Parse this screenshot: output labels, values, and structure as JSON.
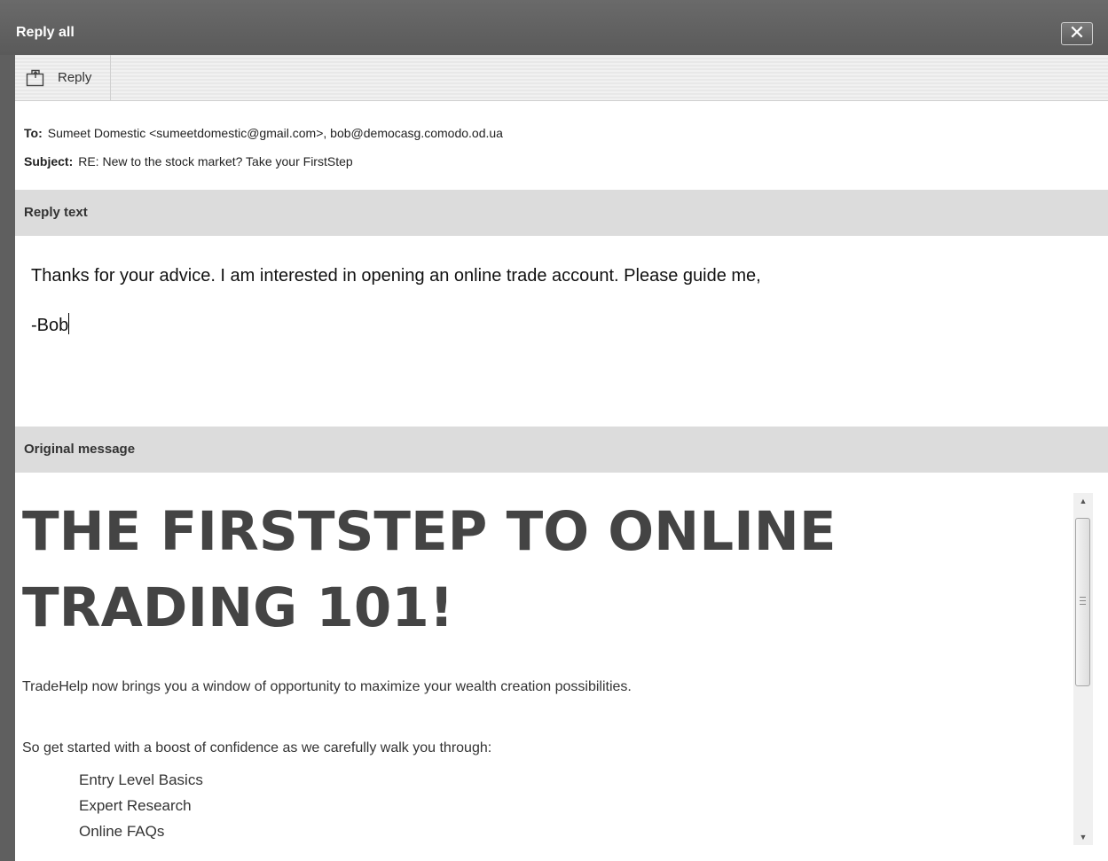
{
  "window": {
    "title": "Reply all",
    "close_label": "✕"
  },
  "toolbar": {
    "reply_label": "Reply"
  },
  "header": {
    "to_label": "To:",
    "to_value": "Sumeet Domestic <sumeetdomestic@gmail.com>, bob@democasg.comodo.od.ua",
    "subject_label": "Subject:",
    "subject_value": "RE: New to the stock market? Take your FirstStep"
  },
  "sections": {
    "reply_text_label": "Reply text",
    "original_message_label": "Original message"
  },
  "reply": {
    "line1": "Thanks for your advice. I am interested in opening an online trade account. Please guide me,",
    "line2": "-Bob"
  },
  "original": {
    "heading": "THE FIRSTSTEP TO ONLINE TRADING 101!",
    "para1": "TradeHelp now brings you a window of opportunity to maximize your wealth creation possibilities.",
    "para2": "So get started with a boost of confidence as we carefully walk you through:",
    "list": [
      "Entry Level Basics",
      "Expert Research",
      "Online FAQs"
    ]
  },
  "colors": {
    "titlebar": "#5f5f5f",
    "section_bar": "#dcdcdc",
    "heading_text": "#444444"
  },
  "icons": {
    "reply": "reply-icon",
    "close": "close-icon"
  }
}
